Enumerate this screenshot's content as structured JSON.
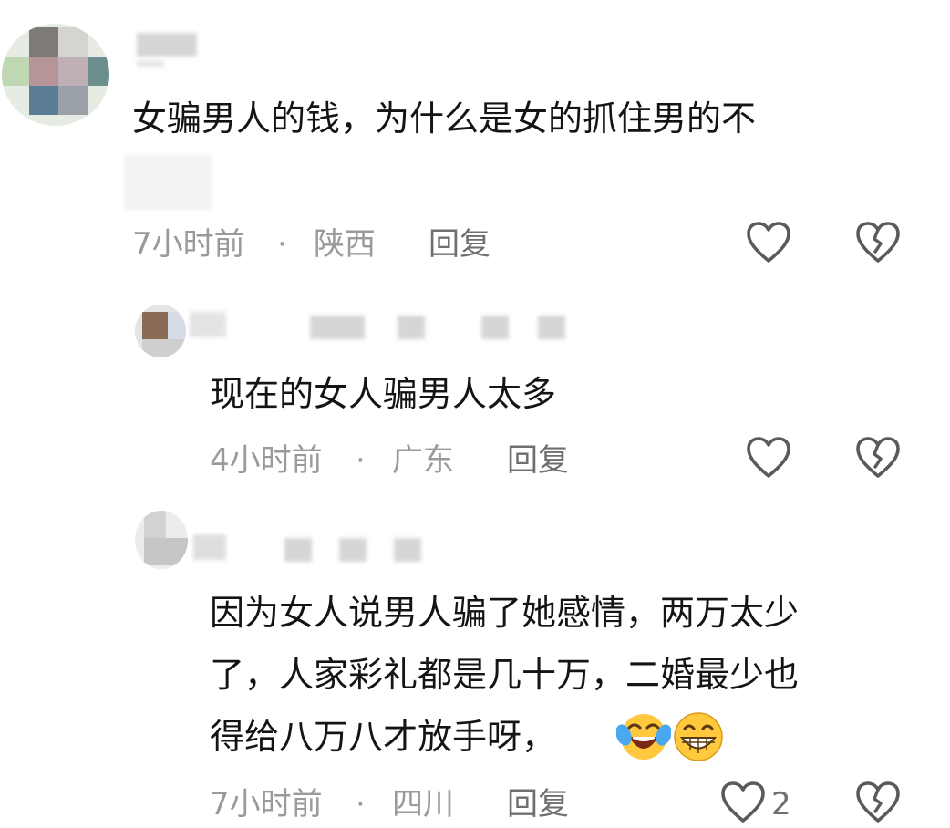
{
  "comments": [
    {
      "text": "女骗男人的钱，为什么是女的抓住男的不",
      "time": "7小时前",
      "sep": "·",
      "location": "陕西",
      "reply_label": "回复"
    },
    {
      "text": "现在的女人骗男人太多",
      "time": "4小时前",
      "sep": "·",
      "location": "广东",
      "reply_label": "回复"
    },
    {
      "lines": [
        "因为女人说男人骗了她感情，两万太少",
        "了，人家彩礼都是几十万，二婚最少也",
        "得给八万八才放手呀，"
      ],
      "time": "7小时前",
      "sep": "·",
      "location": "四川",
      "reply_label": "回复",
      "like_count": "2",
      "emojis": [
        "laughing-tears-emoji",
        "grinning-emoji"
      ]
    }
  ],
  "icons": {
    "like": "heart-outline-icon",
    "dislike": "broken-heart-icon"
  },
  "colors": {
    "text": "#141414",
    "meta": "#9a9a9a",
    "reply": "#6f6f6f",
    "icon": "#5a5a5a"
  }
}
